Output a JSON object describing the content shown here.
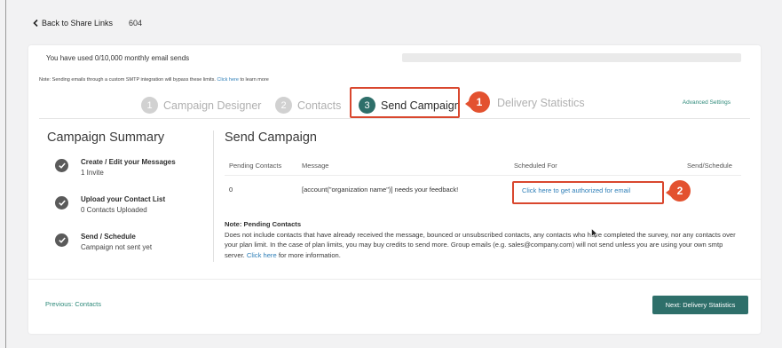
{
  "header": {
    "back_label": "Back to Share Links",
    "link_id": "604"
  },
  "usage": {
    "text": "You have used 0/10,000 monthly email sends",
    "progress_fraction": 0.0
  },
  "smtp_note": {
    "prefix": "Note: Sending emails through a custom SMTP integration will bypass these limits.",
    "link": "Click here",
    "suffix": "to learn more"
  },
  "steps": [
    {
      "num": "1",
      "label": "Campaign Designer"
    },
    {
      "num": "2",
      "label": "Contacts"
    },
    {
      "num": "3",
      "label": "Send Campaign"
    },
    {
      "num": "",
      "label": "Delivery Statistics"
    }
  ],
  "advanced_settings": "Advanced Settings",
  "callouts": [
    "1",
    "2"
  ],
  "summary": {
    "title": "Campaign Summary",
    "items": [
      {
        "title": "Create / Edit your Messages",
        "sub": "1 Invite"
      },
      {
        "title": "Upload your Contact List",
        "sub": "0 Contacts Uploaded"
      },
      {
        "title": "Send / Schedule",
        "sub": "Campaign not sent yet"
      }
    ]
  },
  "send": {
    "title": "Send Campaign",
    "columns": [
      "Pending Contacts",
      "Message",
      "Scheduled For",
      "Send/Schedule"
    ],
    "row": {
      "pending": "0",
      "message": "[account(\"organization name\")] needs your feedback!",
      "scheduled_link": "Click here to get authorized for email"
    }
  },
  "pending_note": {
    "heading": "Note: Pending Contacts",
    "body": "Does not include contacts that have already received the message, bounced or unsubscribed contacts, any contacts who have completed the survey, nor any contacts over your plan limit. In the case of plan limits, you may buy credits to send more. Group emails (e.g. sales@company.com) will not send unless you are using your own smtp server.",
    "link": "Click here",
    "suffix": "for more information."
  },
  "footer": {
    "previous": "Previous: Contacts",
    "next": "Next: Delivery Statistics"
  },
  "colors": {
    "accent": "#2e6f6a",
    "highlight": "#d9472e",
    "link": "#2f7fb8"
  }
}
